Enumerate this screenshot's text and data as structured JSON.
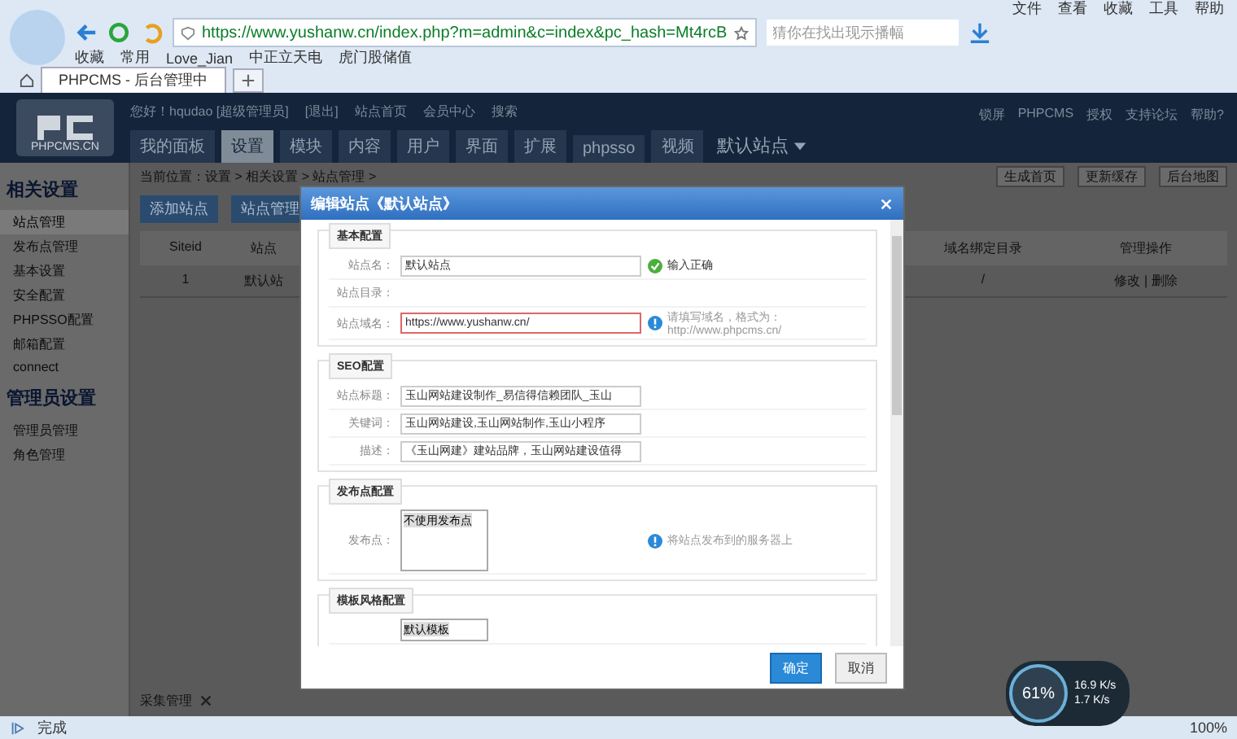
{
  "browser": {
    "menu": [
      "文件",
      "查看",
      "收藏",
      "工具",
      "帮助"
    ],
    "url": "https://www.yushanw.cn/index.php?m=admin&c=index&pc_hash=Mt4rcB",
    "search_placeholder": "猜你在找出现示播幅",
    "bookmarks": [
      "收藏",
      "常用",
      "Love_Jian",
      "中正立天电",
      "虎门股储值"
    ],
    "tabs": [
      {
        "label": "PHPCMS - 后台管理中",
        "selected": true
      }
    ],
    "status": "完成",
    "zoom": "100%"
  },
  "header": {
    "logo": "PHPCMS.CN",
    "top_links": [
      "您好！hqudao [超级管理员]",
      "[退出]",
      "站点首页",
      "会员中心",
      "搜索"
    ],
    "nav": [
      {
        "label": "我的面板",
        "selected": false
      },
      {
        "label": "设置",
        "selected": true
      },
      {
        "label": "模块",
        "selected": false
      },
      {
        "label": "内容",
        "selected": false
      },
      {
        "label": "用户",
        "selected": false
      },
      {
        "label": "界面",
        "selected": false
      },
      {
        "label": "扩展",
        "selected": false
      },
      {
        "label": "phpsso",
        "selected": false
      },
      {
        "label": "视频",
        "selected": false
      }
    ],
    "site_switch": "默认站点",
    "right_links": [
      "锁屏",
      "PHPCMS",
      "授权",
      "支持论坛",
      "帮助?"
    ]
  },
  "sidebar": [
    {
      "title": "相关设置",
      "items": [
        {
          "label": "站点管理",
          "selected": true
        },
        {
          "label": "发布点管理",
          "selected": false
        },
        {
          "label": "基本设置",
          "selected": false
        },
        {
          "label": "安全配置",
          "selected": false
        },
        {
          "label": "PHPSSO配置",
          "selected": false
        },
        {
          "label": "邮箱配置",
          "selected": false
        },
        {
          "label": "connect",
          "selected": false
        }
      ]
    },
    {
      "title": "管理员设置",
      "items": [
        {
          "label": "管理员管理",
          "selected": false
        },
        {
          "label": "角色管理",
          "selected": false
        }
      ]
    }
  ],
  "content": {
    "breadcrumb": "当前位置：设置 > 相关设置 > 站点管理 >",
    "buttons": [
      "添加站点",
      "站点管理"
    ],
    "right_buttons": [
      "生成首页",
      "更新缓存",
      "后台地图"
    ],
    "table": {
      "columns": [
        "Siteid",
        "站点",
        "域名绑定目录",
        "管理操作"
      ],
      "rows": [
        [
          "1",
          "默认站",
          "/",
          "修改 | 删除"
        ]
      ]
    },
    "bottom_tab": "采集管理"
  },
  "dialog": {
    "title": "编辑站点《默认站点》",
    "sections": [
      {
        "title": "基本配置",
        "fields": [
          {
            "label": "站点名：",
            "kind": "text",
            "value": "默认站点",
            "error": false,
            "hint": {
              "kind": "ok",
              "text": "输入正确"
            }
          },
          {
            "label": "站点目录：",
            "kind": "none"
          },
          {
            "label": "站点域名：",
            "kind": "text",
            "value": "https://www.yushanw.cn/",
            "error": true,
            "hint": {
              "kind": "info",
              "text": "请填写域名，格式为：http://www.phpcms.cn/"
            }
          }
        ]
      },
      {
        "title": "SEO配置",
        "fields": [
          {
            "label": "站点标题：",
            "kind": "text",
            "value": "玉山网站建设制作_易信得信赖团队_玉山",
            "error": false
          },
          {
            "label": "关键词：",
            "kind": "text",
            "value": "玉山网站建设,玉山网站制作,玉山小程序",
            "error": false
          },
          {
            "label": "描述：",
            "kind": "text",
            "value": "《玉山网建》建站品牌，玉山网站建设值得",
            "error": false
          }
        ]
      },
      {
        "title": "发布点配置",
        "fields": [
          {
            "label": "发布点：",
            "kind": "list",
            "value": "不使用发布点",
            "hint": {
              "kind": "info",
              "text": "将站点发布到的服务器上"
            }
          }
        ]
      },
      {
        "title": "模板风格配置",
        "fields": [
          {
            "kind": "shortlist",
            "value": "默认模板"
          }
        ]
      }
    ],
    "buttons": [
      {
        "label": "确定",
        "primary": true
      },
      {
        "label": "取消",
        "primary": false
      }
    ]
  },
  "widget": {
    "percent": "61%",
    "upload": "16.9 K/s",
    "download": "1.7 K/s"
  }
}
